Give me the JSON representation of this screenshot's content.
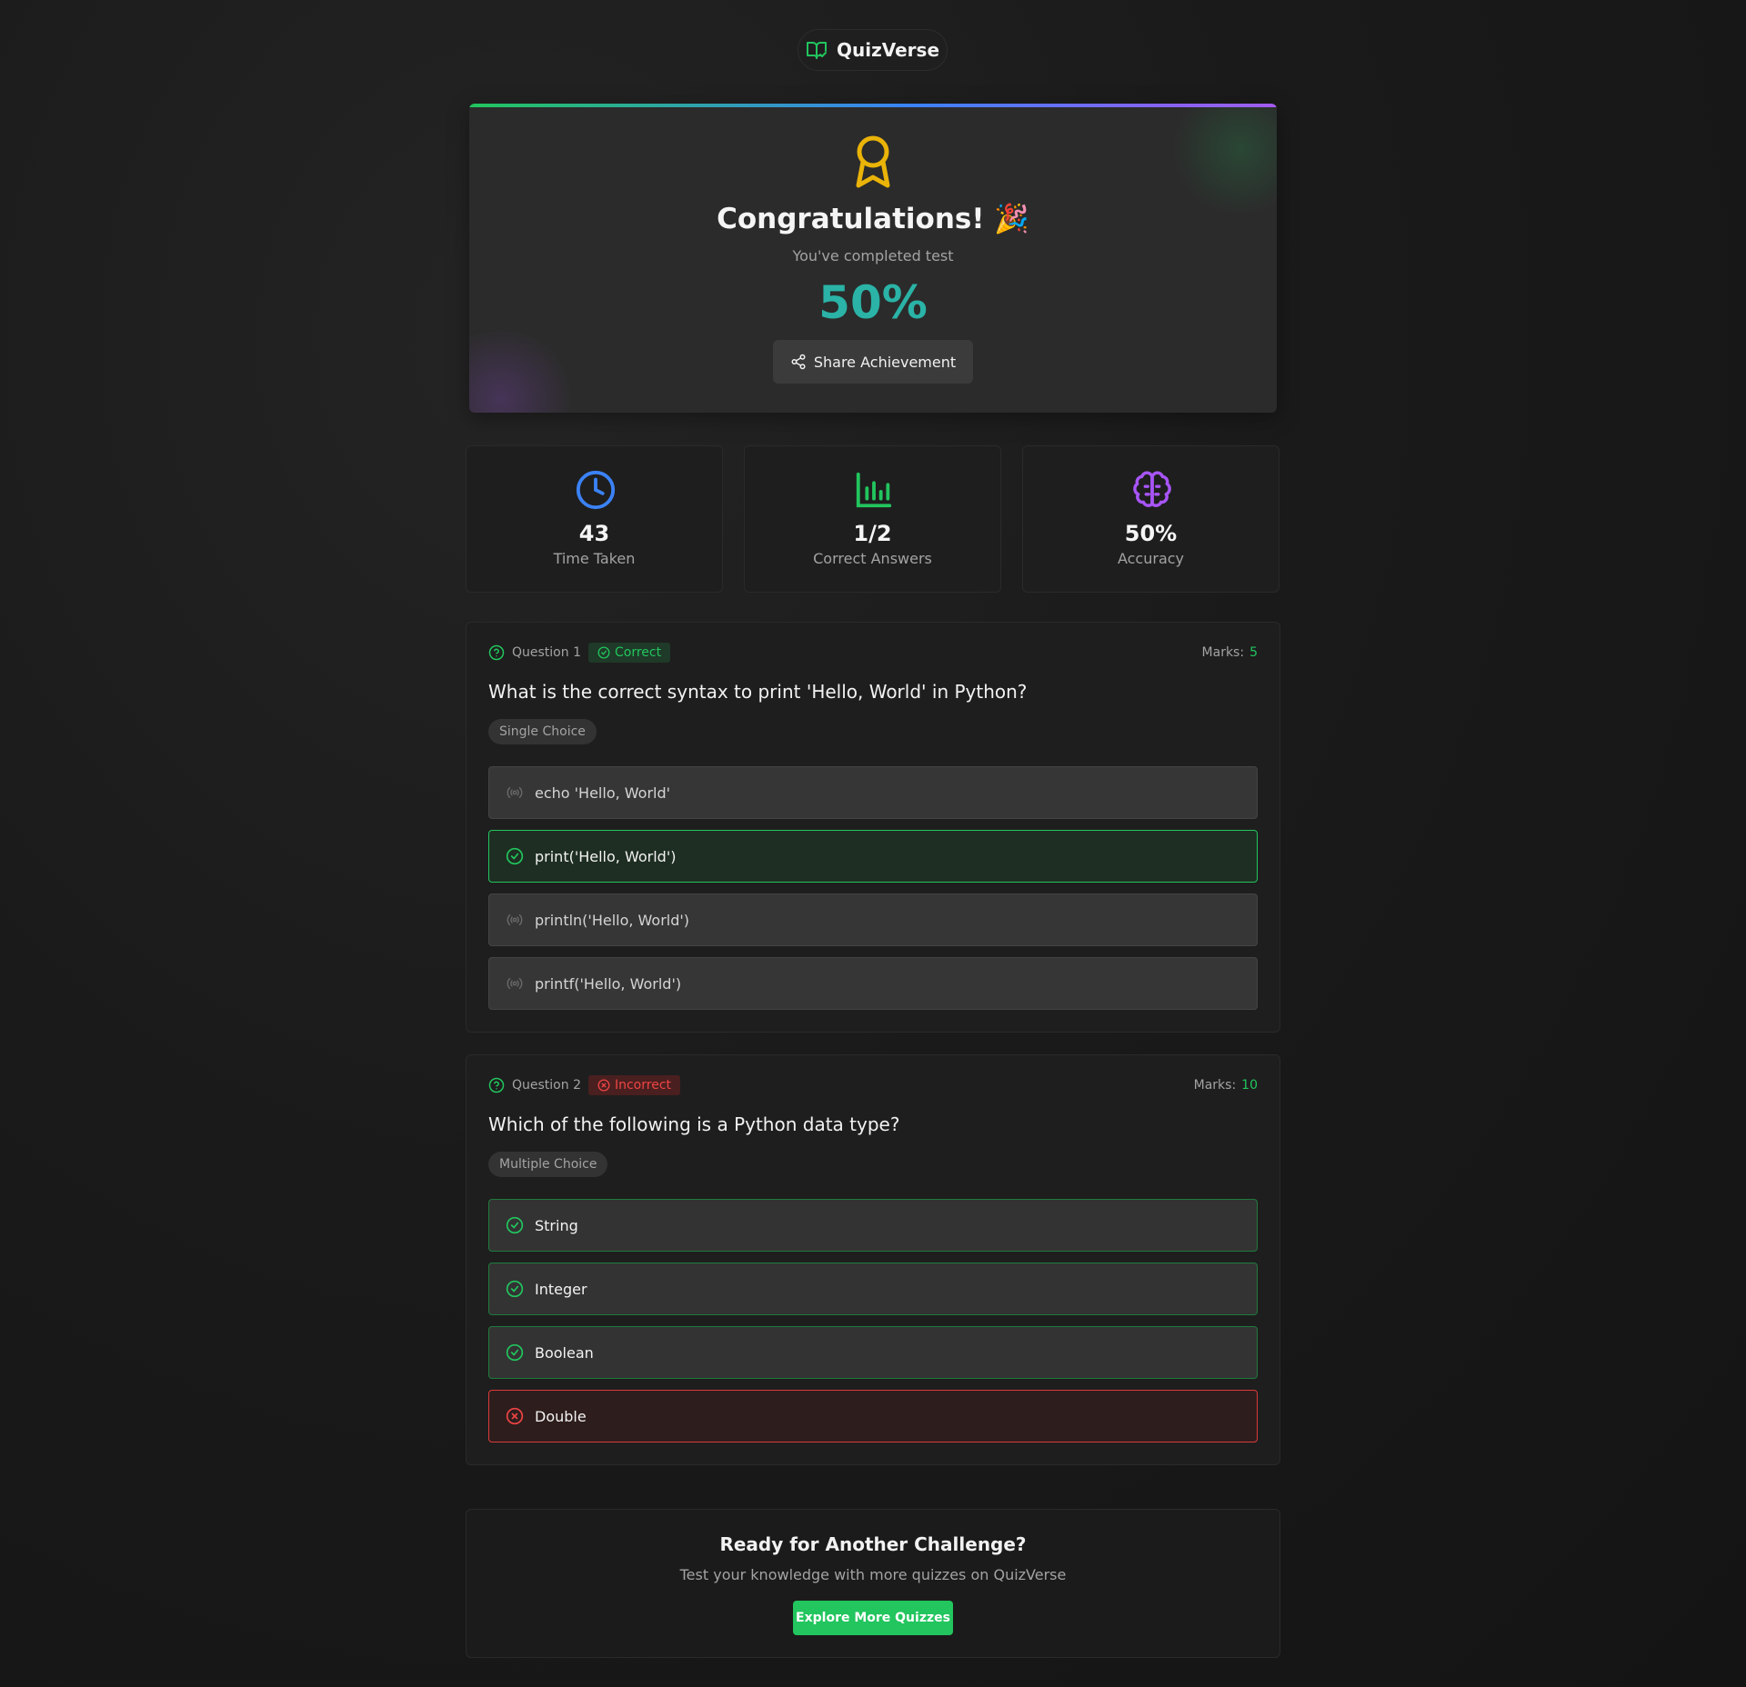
{
  "brand": {
    "name": "QuizVerse",
    "icon": "book-open-check-icon"
  },
  "hero": {
    "icon": "award-icon",
    "title": "Congratulations! 🎉",
    "subtitle": "You've completed test",
    "score": "50%",
    "share_label": "Share Achievement",
    "accent_gradient": [
      "#22c55e",
      "#3b82f6",
      "#a855f7"
    ],
    "score_color": "#2ab3a6"
  },
  "stats": [
    {
      "value": "43",
      "label": "Time Taken",
      "icon": "clock-icon",
      "color": "#3b82f6"
    },
    {
      "value": "1/2",
      "label": "Correct Answers",
      "icon": "bar-chart-icon",
      "color": "#22c55e"
    },
    {
      "value": "50%",
      "label": "Accuracy",
      "icon": "brain-icon",
      "color": "#a855f7"
    }
  ],
  "questions": [
    {
      "label": "Question 1",
      "status": "Correct",
      "marks_label": "Marks:",
      "marks": "5",
      "text": "What is the correct syntax to print 'Hello, World' in Python?",
      "type": "Single Choice",
      "options": [
        {
          "text": "echo 'Hello, World'",
          "state": "neutral"
        },
        {
          "text": "print('Hello, World')",
          "state": "correct-selected"
        },
        {
          "text": "println('Hello, World')",
          "state": "neutral"
        },
        {
          "text": "printf('Hello, World')",
          "state": "neutral"
        }
      ]
    },
    {
      "label": "Question 2",
      "status": "Incorrect",
      "marks_label": "Marks:",
      "marks": "10",
      "text": "Which of the following is a Python data type?",
      "type": "Multiple Choice",
      "options": [
        {
          "text": "String",
          "state": "correct"
        },
        {
          "text": "Integer",
          "state": "correct"
        },
        {
          "text": "Boolean",
          "state": "correct"
        },
        {
          "text": "Double",
          "state": "wrong"
        }
      ]
    }
  ],
  "cta": {
    "title": "Ready for Another Challenge?",
    "subtitle": "Test your knowledge with more quizzes on QuizVerse",
    "button_label": "Explore More Quizzes",
    "button_color": "#22c55e"
  }
}
